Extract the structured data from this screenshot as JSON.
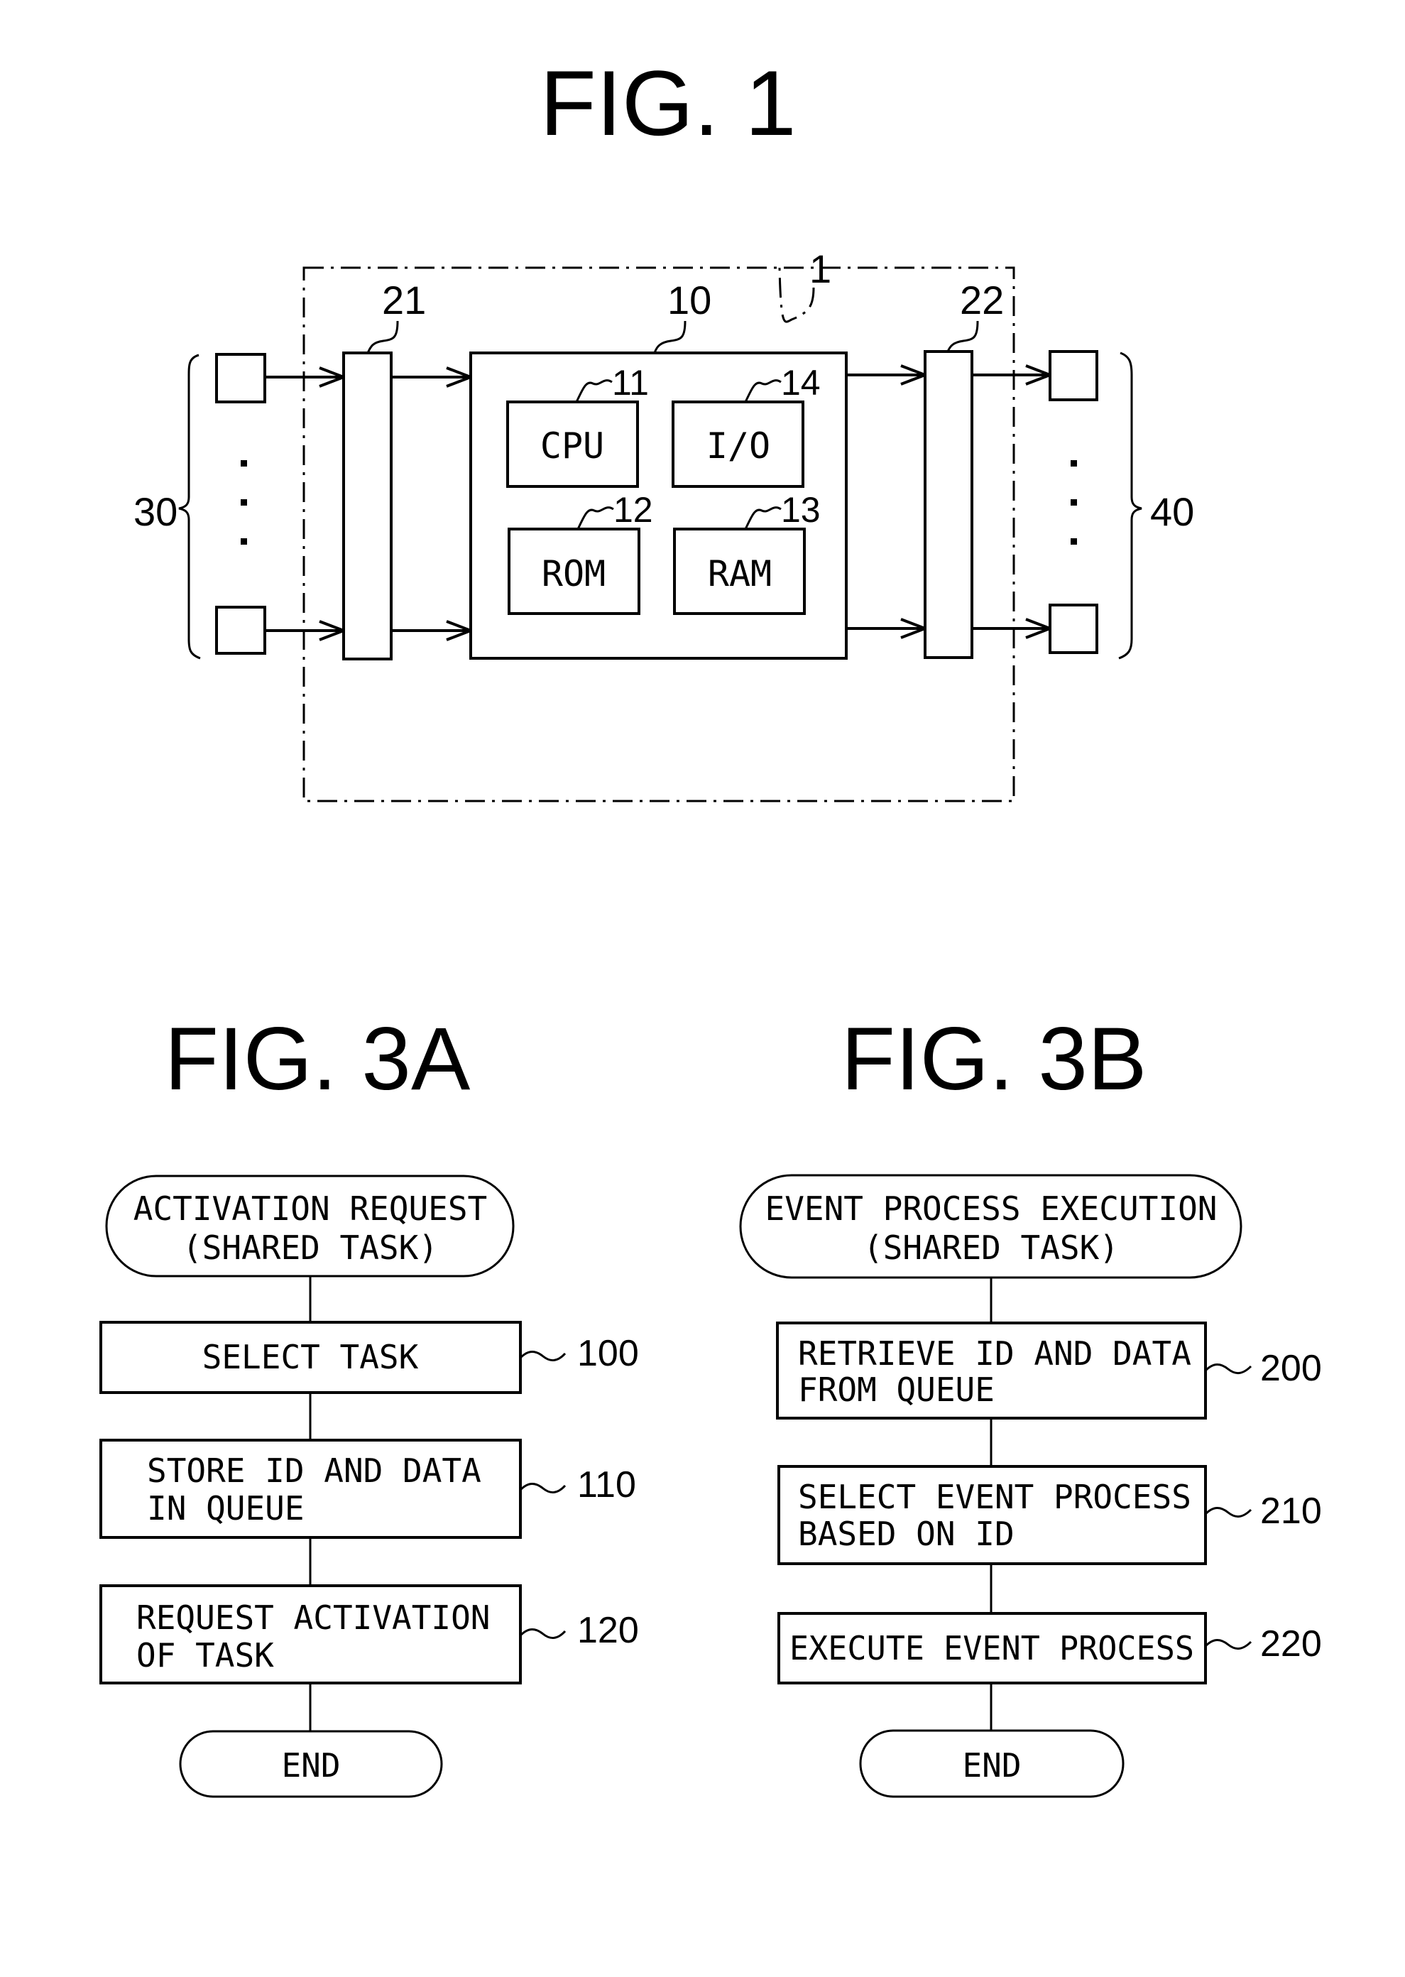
{
  "fig1": {
    "title": "FIG. 1",
    "labels": {
      "system": "1",
      "controller": "10",
      "cpu_ref": "11",
      "rom_ref": "12",
      "ram_ref": "13",
      "io_ref": "14",
      "input_circuit": "21",
      "output_circuit": "22",
      "inputs": "30",
      "outputs": "40"
    },
    "blocks": {
      "cpu": "CPU",
      "io": "I/O",
      "rom": "ROM",
      "ram": "RAM"
    }
  },
  "fig3a": {
    "title": "FIG. 3A",
    "start_line1": "ACTIVATION REQUEST",
    "start_line2": "(SHARED TASK)",
    "steps": [
      {
        "ref": "100",
        "lines": [
          "SELECT TASK"
        ]
      },
      {
        "ref": "110",
        "lines": [
          "STORE ID AND DATA",
          "IN QUEUE"
        ]
      },
      {
        "ref": "120",
        "lines": [
          "REQUEST ACTIVATION",
          "OF TASK"
        ]
      }
    ],
    "end": "END"
  },
  "fig3b": {
    "title": "FIG. 3B",
    "start_line1": "EVENT PROCESS EXECUTION",
    "start_line2": "(SHARED TASK)",
    "steps": [
      {
        "ref": "200",
        "lines": [
          "RETRIEVE ID AND DATA",
          "FROM QUEUE"
        ]
      },
      {
        "ref": "210",
        "lines": [
          "SELECT EVENT PROCESS",
          "BASED ON ID"
        ]
      },
      {
        "ref": "220",
        "lines": [
          "EXECUTE EVENT PROCESS"
        ]
      }
    ],
    "end": "END"
  }
}
